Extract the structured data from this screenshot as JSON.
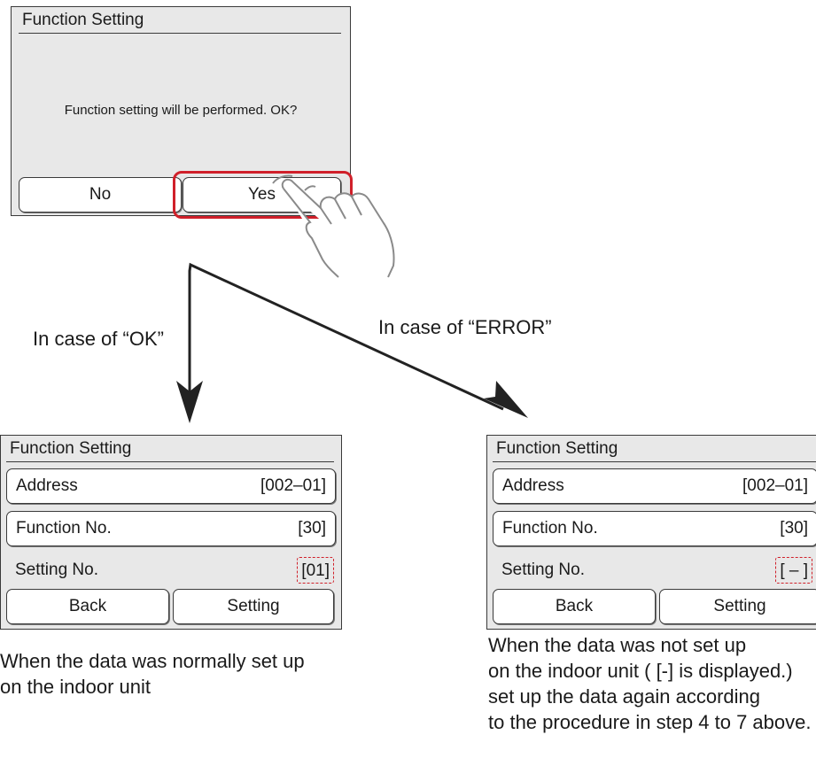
{
  "confirm_dialog": {
    "title": "Function Setting",
    "message": "Function setting will be performed. OK?",
    "no_label": "No",
    "yes_label": "Yes"
  },
  "branches": {
    "ok_label": "In case of “OK”",
    "error_label": "In case of “ERROR”"
  },
  "ok_panel": {
    "title": "Function Setting",
    "address_label": "Address",
    "address_value": "[002–01]",
    "function_label": "Function No.",
    "function_value": "[30]",
    "setting_label": "Setting No.",
    "setting_value": "[01]",
    "back_label": "Back",
    "setting_button_label": "Setting",
    "caption_line1": "When the data was normally set up",
    "caption_line2": "on the indoor unit"
  },
  "error_panel": {
    "title": "Function Setting",
    "address_label": "Address",
    "address_value": "[002–01]",
    "function_label": "Function No.",
    "function_value": "[30]",
    "setting_label": "Setting No.",
    "setting_value": "[ – ]",
    "back_label": "Back",
    "setting_button_label": "Setting",
    "caption_line1": "When the data was not set up",
    "caption_line2": "on the indoor unit ( [-] is displayed.)",
    "caption_line3": "set up the data again according",
    "caption_line4": "to the procedure in step 4 to 7 above."
  },
  "colors": {
    "highlight": "#d0202a",
    "panel_bg": "#e8e8e8"
  }
}
